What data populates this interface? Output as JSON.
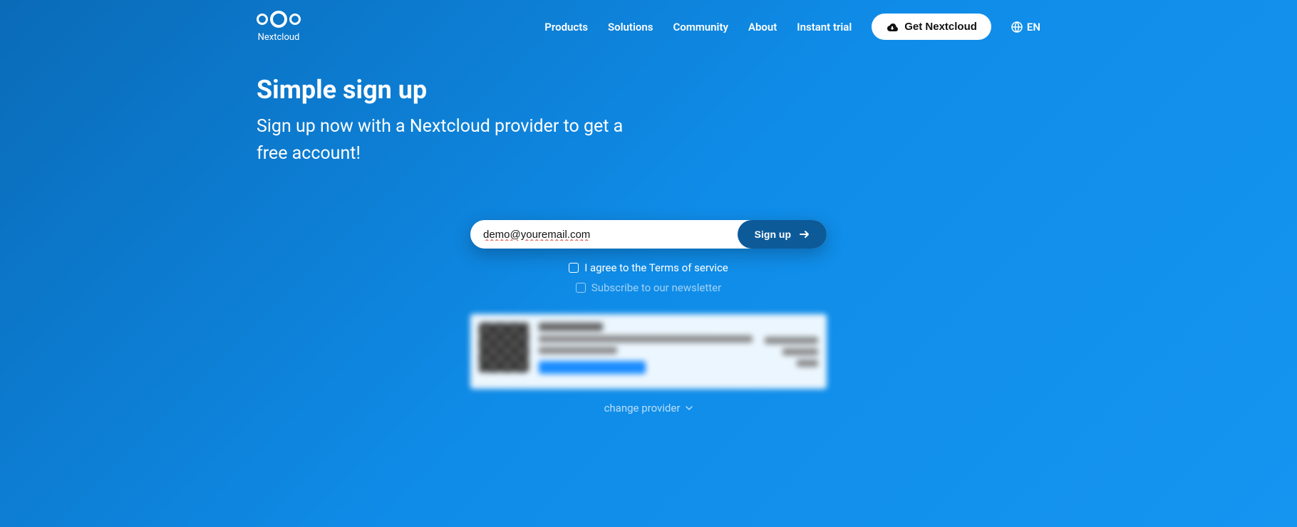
{
  "brand": {
    "name": "Nextcloud"
  },
  "nav": {
    "products": "Products",
    "solutions": "Solutions",
    "community": "Community",
    "about": "About",
    "instant_trial": "Instant trial",
    "get_button": "Get Nextcloud",
    "language": "EN"
  },
  "hero": {
    "title": "Simple sign up",
    "subtitle": "Sign up now with a Nextcloud provider to get a free account!"
  },
  "form": {
    "email_value": "demo@youremail.com",
    "signup_button": "Sign up",
    "terms_label": "I agree to the Terms of service",
    "newsletter_label": "Subscribe to our newsletter"
  },
  "change_provider_label": "change provider"
}
